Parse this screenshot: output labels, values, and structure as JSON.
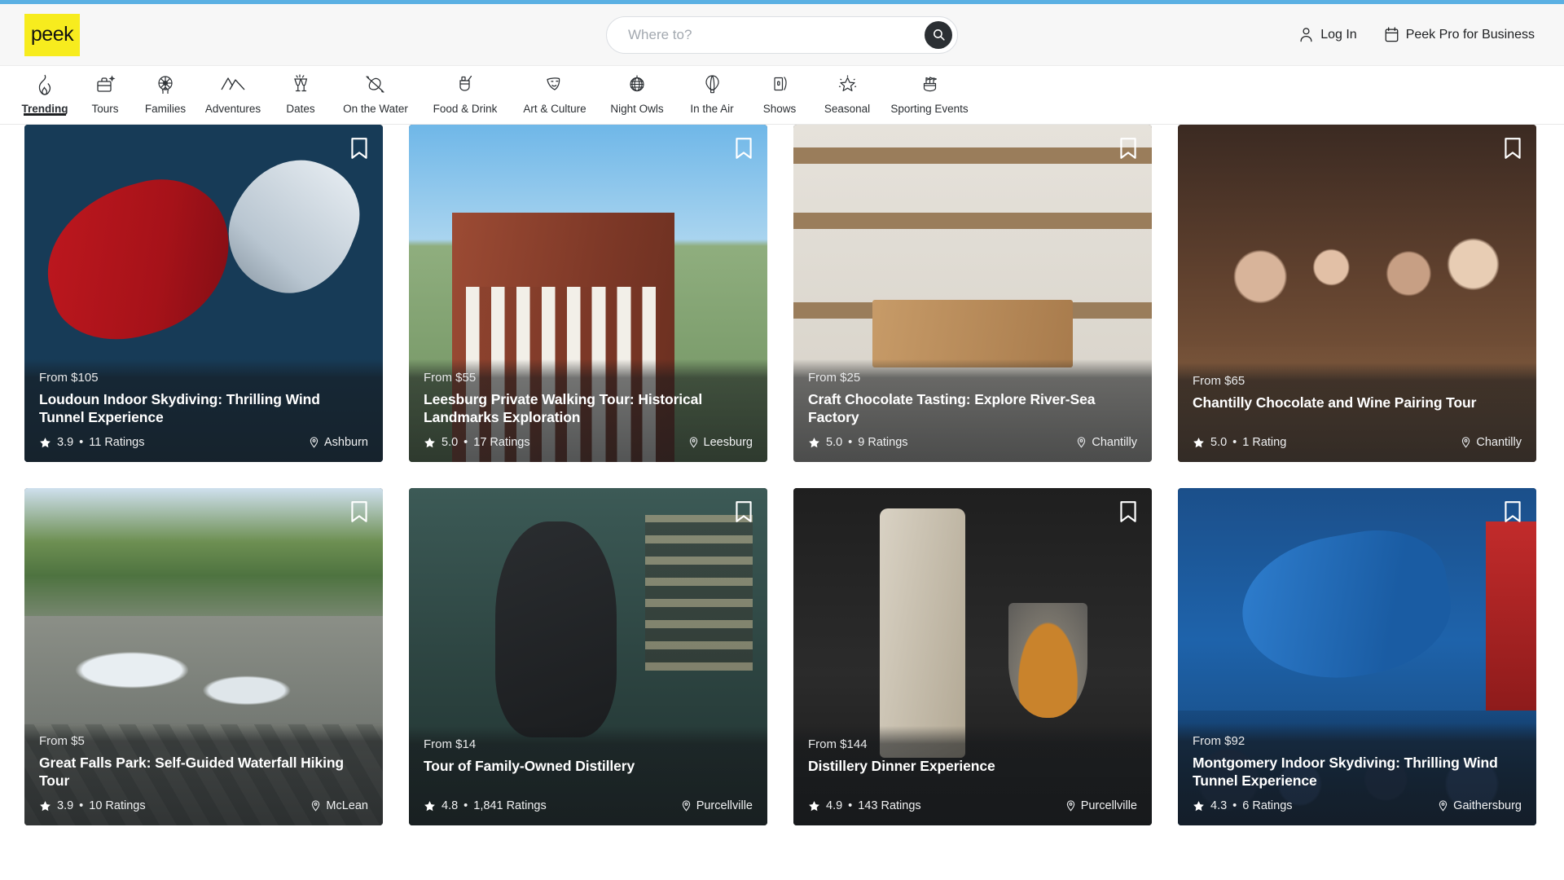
{
  "header": {
    "logo_text": "peek",
    "search": {
      "placeholder": "Where to?",
      "value": "",
      "icon": "search-icon"
    },
    "login_label": "Log In",
    "login_icon": "user-icon",
    "business_label": "Peek Pro for Business",
    "business_icon": "calendar-icon",
    "accent_color": "#5bb0e3",
    "logo_bg": "#f7ec1e"
  },
  "categories": [
    {
      "label": "Trending",
      "icon": "flame-icon",
      "active": true
    },
    {
      "label": "Tours",
      "icon": "suitcase-icon",
      "active": false
    },
    {
      "label": "Families",
      "icon": "ferris-wheel-icon",
      "active": false
    },
    {
      "label": "Adventures",
      "icon": "mountains-icon",
      "active": false
    },
    {
      "label": "Dates",
      "icon": "champagne-glasses-icon",
      "active": false
    },
    {
      "label": "On the Water",
      "icon": "kayak-icon",
      "active": false
    },
    {
      "label": "Food & Drink",
      "icon": "cocktail-icon",
      "active": false
    },
    {
      "label": "Art & Culture",
      "icon": "theater-masks-icon",
      "active": false
    },
    {
      "label": "Night Owls",
      "icon": "disco-ball-icon",
      "active": false
    },
    {
      "label": "In the Air",
      "icon": "hot-air-balloon-icon",
      "active": false
    },
    {
      "label": "Shows",
      "icon": "ticket-icon",
      "active": false
    },
    {
      "label": "Seasonal",
      "icon": "sparkle-star-icon",
      "active": false
    },
    {
      "label": "Sporting Events",
      "icon": "stadium-icon",
      "active": false
    }
  ],
  "cards": [
    {
      "price": "From $105",
      "title": "Loudoun Indoor Skydiving: Thrilling Wind Tunnel Experience",
      "rating": "3.9",
      "separator": "•",
      "ratings_count": "11 Ratings",
      "location": "Ashburn",
      "photo": "indoor-skydiving-wind-tunnel",
      "bookmark_icon": "bookmark-icon"
    },
    {
      "price": "From $55",
      "title": "Leesburg Private Walking Tour: Historical Landmarks Exploration",
      "rating": "5.0",
      "separator": "•",
      "ratings_count": "17 Ratings",
      "location": "Leesburg",
      "photo": "historic-brick-courthouse",
      "bookmark_icon": "bookmark-icon"
    },
    {
      "price": "From $25",
      "title": "Craft Chocolate Tasting: Explore River-Sea Factory",
      "rating": "5.0",
      "separator": "•",
      "ratings_count": "9 Ratings",
      "location": "Chantilly",
      "photo": "chocolate-shop-shelves",
      "bookmark_icon": "bookmark-icon"
    },
    {
      "price": "From $65",
      "title": "Chantilly Chocolate and Wine Pairing Tour",
      "rating": "5.0",
      "separator": "•",
      "ratings_count": "1 Rating",
      "location": "Chantilly",
      "photo": "group-at-wine-table",
      "bookmark_icon": "bookmark-icon"
    },
    {
      "price": "From $5",
      "title": "Great Falls Park: Self-Guided Waterfall Hiking Tour",
      "rating": "3.9",
      "separator": "•",
      "ratings_count": "10 Ratings",
      "location": "McLean",
      "photo": "river-rapids-waterfall",
      "bookmark_icon": "bookmark-icon"
    },
    {
      "price": "From $14",
      "title": "Tour of Family-Owned Distillery",
      "rating": "4.8",
      "separator": "•",
      "ratings_count": "1,841 Ratings",
      "location": "Purcellville",
      "photo": "distillery-tasting-woman",
      "bookmark_icon": "bookmark-icon"
    },
    {
      "price": "From $144",
      "title": "Distillery Dinner Experience",
      "rating": "4.9",
      "separator": "•",
      "ratings_count": "143 Ratings",
      "location": "Purcellville",
      "photo": "whiskey-bottle-and-glass",
      "bookmark_icon": "bookmark-icon"
    },
    {
      "price": "From $92",
      "title": "Montgomery Indoor Skydiving: Thrilling Wind Tunnel Experience",
      "rating": "4.3",
      "separator": "•",
      "ratings_count": "6 Ratings",
      "location": "Gaithersburg",
      "photo": "ifly-indoor-skydiving",
      "bookmark_icon": "bookmark-icon"
    }
  ]
}
